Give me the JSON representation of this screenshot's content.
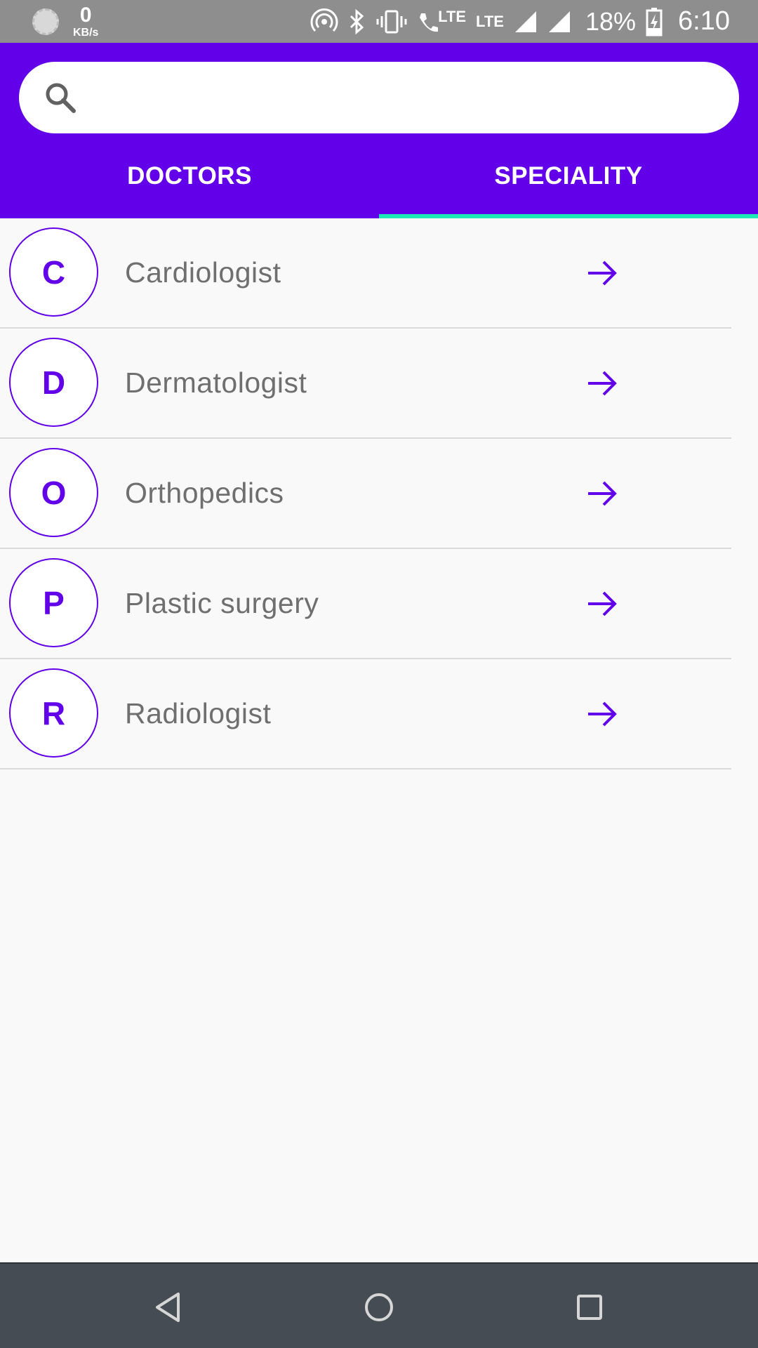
{
  "status_bar": {
    "speed_value": "0",
    "speed_unit": "KB/s",
    "lte_1": "LTE",
    "lte_2": "LTE",
    "battery": "18%",
    "time": "6:10"
  },
  "search": {
    "value": "",
    "placeholder": ""
  },
  "tabs": [
    {
      "label": "DOCTORS",
      "selected": false
    },
    {
      "label": "SPECIALITY",
      "selected": true
    }
  ],
  "specialities": [
    {
      "initial": "C",
      "name": "Cardiologist"
    },
    {
      "initial": "D",
      "name": "Dermatologist"
    },
    {
      "initial": "O",
      "name": "Orthopedics"
    },
    {
      "initial": "P",
      "name": "Plastic surgery"
    },
    {
      "initial": "R",
      "name": "Radiologist"
    }
  ],
  "colors": {
    "primary": "#6200ea",
    "tab_indicator": "#1de9b6",
    "status_bar": "#8e8e8e",
    "nav_bar": "#454c53",
    "item_text": "#6f6f6f"
  },
  "icons": {
    "search": "search-icon",
    "row_action": "arrow-right-icon",
    "nav_back": "back-triangle-icon",
    "nav_home": "home-circle-icon",
    "nav_recents": "recents-square-icon"
  }
}
